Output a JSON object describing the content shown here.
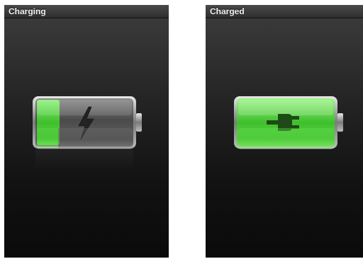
{
  "screens": [
    {
      "status_text": "Charging",
      "battery": {
        "charge_level": 0.24,
        "indicator": "lightning-bolt-icon",
        "fill_color": "#4ecb3a"
      }
    },
    {
      "status_text": "Charged",
      "battery": {
        "charge_level": 1.0,
        "indicator": "power-plug-icon",
        "fill_color": "#4ecb3a"
      }
    }
  ]
}
